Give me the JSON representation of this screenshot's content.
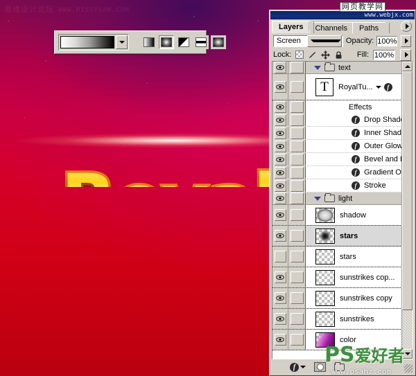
{
  "canvas": {
    "artwork_text": "Royal",
    "watermark_left": "思缘设计论坛",
    "watermark_left_url": "WWW.MISSYUAN.COM",
    "accent_yellow": "#ffd21a",
    "accent_orange": "#f07a18",
    "bg_magenta": "#cb0040",
    "bg_red": "#c60012"
  },
  "gradient_toolbar": {
    "preview_name": "gradient-preview",
    "dropdown_icon": "chevron-down-icon",
    "types": [
      {
        "name": "linear-gradient",
        "selected": false
      },
      {
        "name": "radial-gradient",
        "selected": true
      },
      {
        "name": "angle-gradient",
        "selected": false
      },
      {
        "name": "reflected-gradient",
        "selected": false
      },
      {
        "name": "diamond-gradient",
        "selected": false
      }
    ]
  },
  "palette": {
    "titlebar_watermark": "www.webjx.com",
    "corner_watermark": "网页教学网",
    "tabs": [
      {
        "label": "Layers",
        "active": true
      },
      {
        "label": "Channels",
        "active": false
      },
      {
        "label": "Paths",
        "active": false
      }
    ],
    "menu_arrow_icon": "triangle-right-icon",
    "blend_mode": "Screen",
    "opacity_label": "Opacity:",
    "opacity_value": "100%",
    "lock_label": "Lock:",
    "lock_icons": [
      "transparency-icon",
      "brush-icon",
      "move-icon",
      "lock-icon"
    ],
    "fill_label": "Fill:",
    "fill_value": "100%",
    "rows": [
      {
        "kind": "group",
        "name": "text",
        "visible": true,
        "linked": true,
        "expanded": true,
        "selected": false
      },
      {
        "kind": "text-layer",
        "name": "RoyalTu...",
        "visible": true,
        "linked": true,
        "thumb": "T",
        "selected": false,
        "has_fx": true
      },
      {
        "kind": "effects-header",
        "name": "Effects",
        "visible": true,
        "selected": false
      },
      {
        "kind": "effect",
        "name": "Drop Shadow",
        "visible": true
      },
      {
        "kind": "effect",
        "name": "Inner Shadow",
        "visible": true
      },
      {
        "kind": "effect",
        "name": "Outer Glow",
        "visible": true
      },
      {
        "kind": "effect",
        "name": "Bevel and Embo...",
        "visible": true
      },
      {
        "kind": "effect",
        "name": "Gradient Overl...",
        "visible": true
      },
      {
        "kind": "effect",
        "name": "Stroke",
        "visible": true
      },
      {
        "kind": "group",
        "name": "light",
        "visible": true,
        "linked": true,
        "expanded": true,
        "selected": false
      },
      {
        "kind": "layer",
        "name": "shadow",
        "visible": true,
        "linked": true,
        "thumb": "shadow-blob",
        "selected": false
      },
      {
        "kind": "layer",
        "name": "stars",
        "visible": true,
        "linked": true,
        "thumb": "stars-blob",
        "selected": true
      },
      {
        "kind": "layer",
        "name": "stars",
        "visible": false,
        "linked": true,
        "thumb": "empty",
        "selected": false
      },
      {
        "kind": "layer",
        "name": "sunstrikes cop...",
        "visible": true,
        "linked": true,
        "thumb": "empty",
        "selected": false
      },
      {
        "kind": "layer",
        "name": "sunstrikes copy",
        "visible": true,
        "linked": true,
        "thumb": "empty",
        "selected": false
      },
      {
        "kind": "layer",
        "name": "sunstrikes",
        "visible": true,
        "linked": true,
        "thumb": "empty",
        "selected": false
      },
      {
        "kind": "layer",
        "name": "color",
        "visible": true,
        "linked": true,
        "thumb": "color-gradient",
        "selected": false
      }
    ],
    "footer_buttons": [
      "fx-button",
      "add-mask-button",
      "new-group-button"
    ],
    "scroll_up_icon": "triangle-up-icon",
    "scroll_down_icon": "triangle-down-icon"
  },
  "watermarks": {
    "ps_brand": "PS",
    "ps_brand_cn": "爱好者",
    "ps_url": "www.psahz.com"
  }
}
